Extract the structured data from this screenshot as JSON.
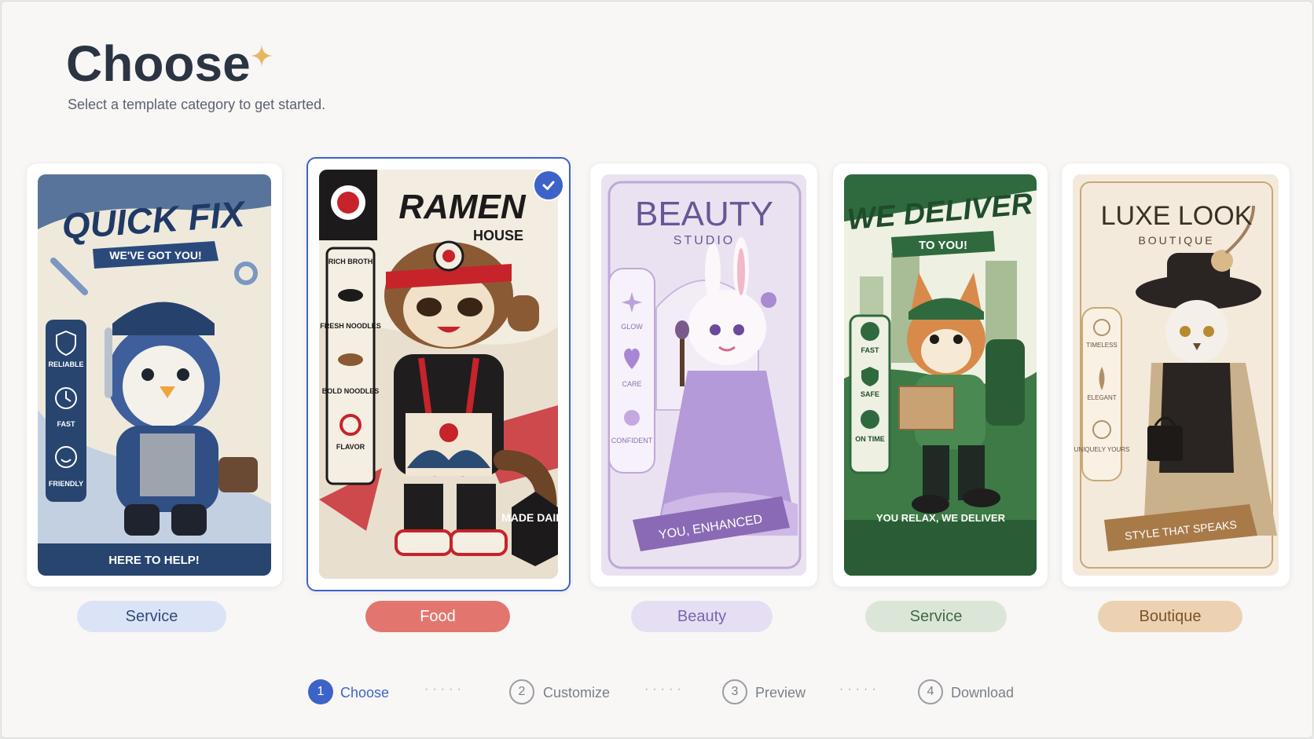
{
  "header": {
    "title": "Choose",
    "subtitle": "Select a template category to get started."
  },
  "templates": [
    {
      "category": "Service",
      "poster_title": "QUICK FIX",
      "poster_tagline": "WE'VE GOT YOU!",
      "features": [
        "RELIABLE",
        "FAST",
        "FRIENDLY"
      ],
      "footer": "HERE TO HELP!",
      "selected": false
    },
    {
      "category": "Food",
      "poster_title": "RAMEN",
      "poster_subtitle": "HOUSE",
      "features": [
        "RICH BROTH",
        "FRESH NOODLES",
        "BOLD NOODLES",
        "FLAVOR"
      ],
      "badge": "MADE DAILY",
      "selected": true
    },
    {
      "category": "Beauty",
      "poster_title": "BEAUTY",
      "poster_subtitle": "STUDIO",
      "features": [
        "GLOW",
        "CARE",
        "CONFIDENT"
      ],
      "footer": "YOU, ENHANCED",
      "selected": false
    },
    {
      "category": "Service",
      "poster_title": "WE DELIVER",
      "poster_tagline": "TO YOU!",
      "features": [
        "FAST",
        "SAFE",
        "ON TIME"
      ],
      "footer": "YOU RELAX, WE DELIVER",
      "selected": false
    },
    {
      "category": "Boutique",
      "poster_title": "LUXE LOOK",
      "poster_subtitle": "BOUTIQUE",
      "features": [
        "TIMELESS",
        "ELEGANT",
        "UNIQUELY YOURS"
      ],
      "footer": "STYLE THAT SPEAKS",
      "selected": false
    }
  ],
  "steps": [
    {
      "number": "1",
      "label": "Choose",
      "active": true
    },
    {
      "number": "2",
      "label": "Customize",
      "active": false
    },
    {
      "number": "3",
      "label": "Preview",
      "active": false
    },
    {
      "number": "4",
      "label": "Download",
      "active": false
    }
  ],
  "colors": {
    "accent": "#3d63c9",
    "service_pill": "#dbe4f6",
    "food_pill": "#e2766e",
    "beauty_pill": "#e6dff3",
    "delivery_pill": "#dbe6d8",
    "boutique_pill": "#ecd2b2"
  },
  "icons": [
    "sparkle-icon",
    "checkmark-icon",
    "shield-icon",
    "clock-icon",
    "smile-icon",
    "wrench-icon",
    "gear-icon"
  ]
}
